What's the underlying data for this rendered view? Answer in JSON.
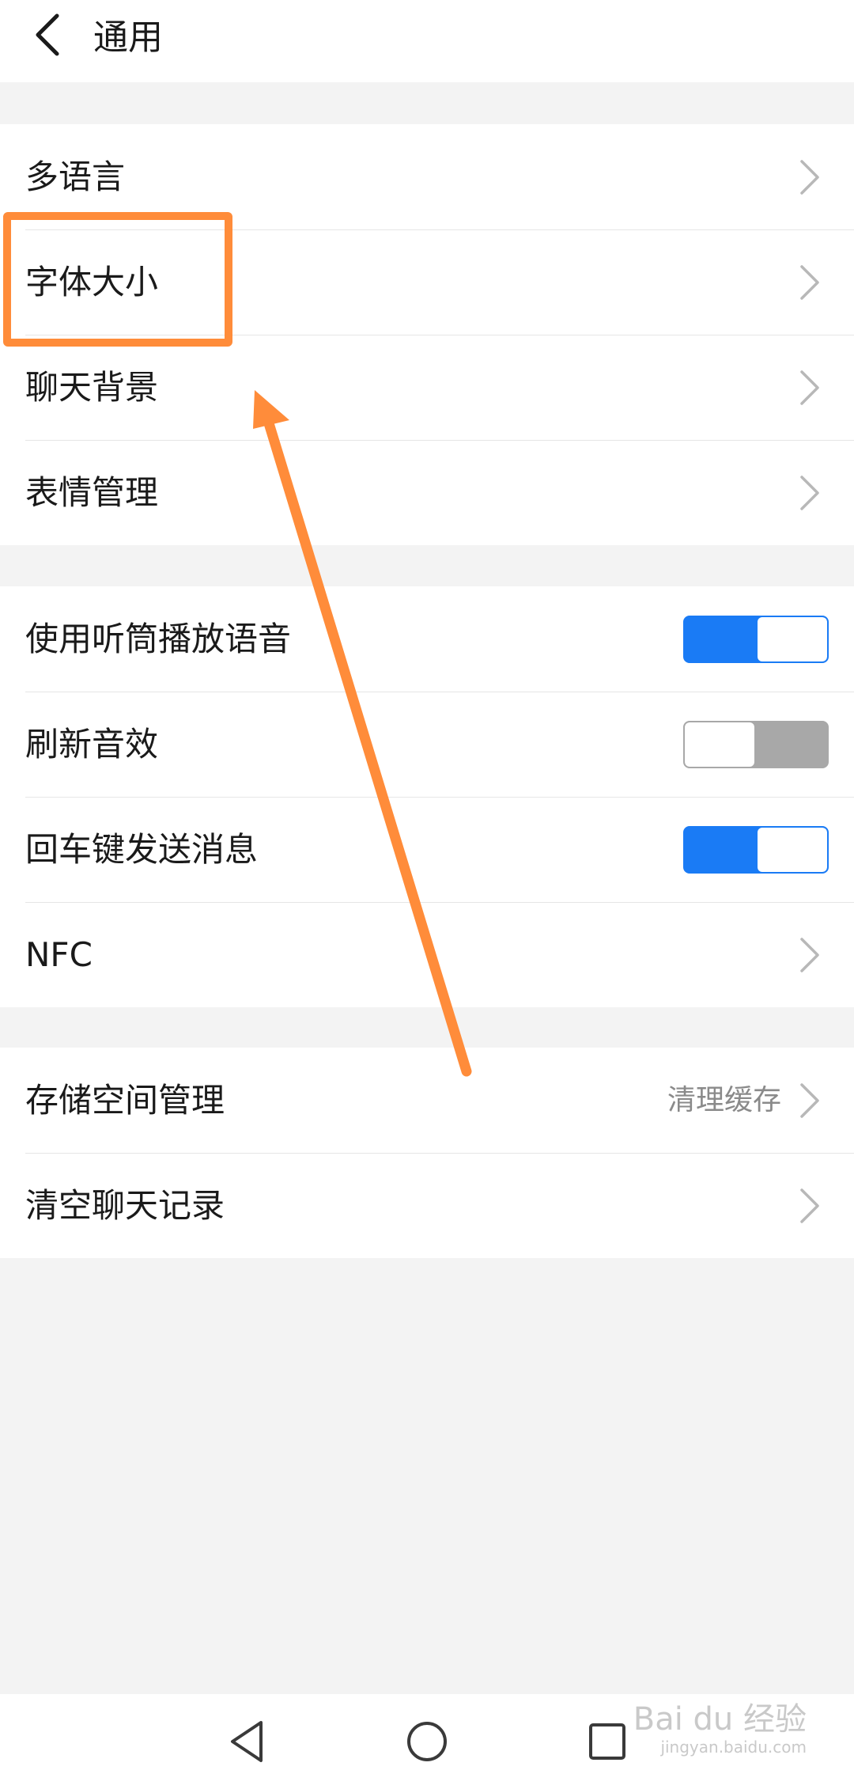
{
  "header": {
    "title": "通用",
    "back_icon": "chevron-left-icon"
  },
  "groups": [
    {
      "rows": [
        {
          "label": "多语言",
          "type": "link"
        },
        {
          "label": "字体大小",
          "type": "link"
        },
        {
          "label": "聊天背景",
          "type": "link"
        },
        {
          "label": "表情管理",
          "type": "link"
        }
      ]
    },
    {
      "rows": [
        {
          "label": "使用听筒播放语音",
          "type": "toggle",
          "on": true
        },
        {
          "label": "刷新音效",
          "type": "toggle",
          "on": false
        },
        {
          "label": "回车键发送消息",
          "type": "toggle",
          "on": true
        },
        {
          "label": "NFC",
          "type": "link"
        }
      ]
    },
    {
      "rows": [
        {
          "label": "存储空间管理",
          "type": "link",
          "value": "清理缓存"
        },
        {
          "label": "清空聊天记录",
          "type": "link"
        }
      ]
    }
  ],
  "nav": {
    "back_icon": "triangle-back-icon",
    "home_icon": "circle-home-icon",
    "recents_icon": "square-recents-icon"
  },
  "watermark": {
    "main": "Bai du 经验",
    "sub": "jingyan.baidu.com"
  },
  "colors": {
    "accent": "#1a7bf5",
    "toggle_off": "#a8a8a8",
    "annotation": "#ff8c3a",
    "background": "#f3f3f3"
  }
}
